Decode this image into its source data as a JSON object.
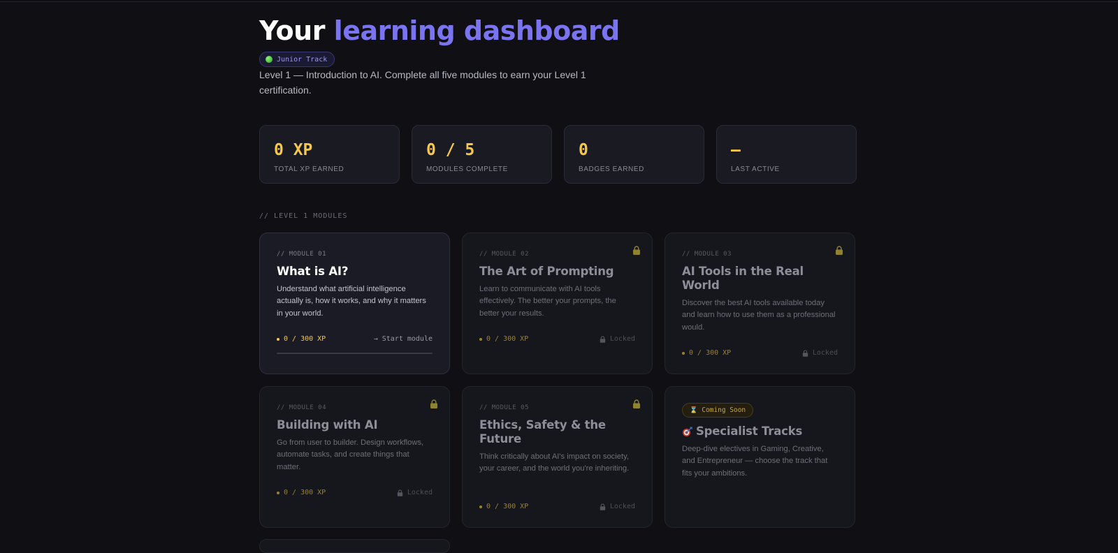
{
  "header": {
    "title_part1": "Your",
    "title_part2": "learning dashboard",
    "track_badge": "Junior Track",
    "intro": "Level 1 — Introduction to AI. Complete all five modules to earn your Level 1 certification."
  },
  "stats": [
    {
      "value": "0 XP",
      "label": "TOTAL XP EARNED"
    },
    {
      "value": "0 / 5",
      "label": "MODULES COMPLETE"
    },
    {
      "value": "0",
      "label": "BADGES EARNED"
    },
    {
      "value": "—",
      "label": "LAST ACTIVE"
    }
  ],
  "section_label": "// LEVEL 1 MODULES",
  "modules": [
    {
      "num": "// MODULE 01",
      "title": "What is AI?",
      "desc": "Understand what artificial intelligence actually is, how it works, and why it matters in your world.",
      "xp": "0 / 300 XP",
      "status": "→ Start module",
      "progress": 0
    },
    {
      "num": "// MODULE 02",
      "title": "The Art of Prompting",
      "desc": "Learn to communicate with AI tools effectively. The better your prompts, the better your results.",
      "xp": "0 / 300 XP",
      "status": "Locked"
    },
    {
      "num": "// MODULE 03",
      "title": "AI Tools in the Real World",
      "desc": "Discover the best AI tools available today and learn how to use them as a professional would.",
      "xp": "0 / 300 XP",
      "status": "Locked"
    },
    {
      "num": "// MODULE 04",
      "title": "Building with AI",
      "desc": "Go from user to builder. Design workflows, automate tasks, and create things that matter.",
      "xp": "0 / 300 XP",
      "status": "Locked"
    },
    {
      "num": "// MODULE 05",
      "title": "Ethics, Safety & the Future",
      "desc": "Think critically about AI's impact on society, your career, and the world you're inheriting.",
      "xp": "0 / 300 XP",
      "status": "Locked"
    }
  ],
  "coming_soon": {
    "badge": "Coming Soon",
    "title": "Specialist Tracks",
    "desc": "Deep-dive electives in Gaming, Creative, and Entrepreneur — choose the track that fits your ambitions."
  },
  "colors": {
    "accent": "#7b74f0",
    "xp_gold": "#f5c84b",
    "background": "#0f0f14"
  },
  "icons": {
    "track": "green-dot-icon",
    "lock": "lock-icon",
    "coming_soon": "hourglass-icon",
    "specialist": "target-icon"
  }
}
